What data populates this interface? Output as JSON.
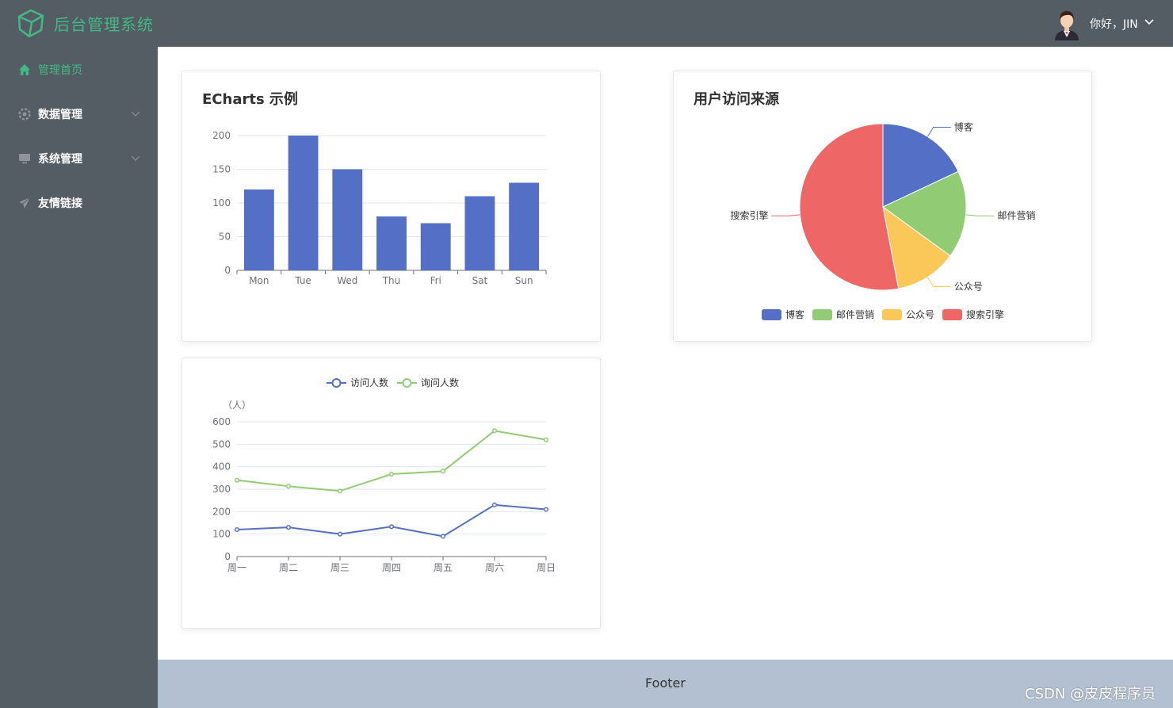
{
  "header": {
    "title": "后台管理系统",
    "greeting": "你好，JIN"
  },
  "sidebar": {
    "items": [
      {
        "label": "管理首页",
        "icon": "home-icon",
        "active": true
      },
      {
        "label": "数据管理",
        "icon": "settings-icon",
        "expandable": true
      },
      {
        "label": "系统管理",
        "icon": "monitor-icon",
        "expandable": true
      },
      {
        "label": "友情链接",
        "icon": "send-icon"
      }
    ]
  },
  "cards": {
    "bar_title": "ECharts 示例",
    "pie_title": "用户访问来源"
  },
  "footer": {
    "text": "Footer"
  },
  "watermark": "CSDN @皮皮程序员",
  "colors": {
    "accent": "#42b983",
    "sidebar": "#545c64",
    "footer": "#b3c0d1",
    "blue": "#5470c6",
    "green": "#91cc75",
    "yellow": "#fac858",
    "red": "#ee6666"
  },
  "chart_data": [
    {
      "type": "bar",
      "categories": [
        "Mon",
        "Tue",
        "Wed",
        "Thu",
        "Fri",
        "Sat",
        "Sun"
      ],
      "values": [
        120,
        200,
        150,
        80,
        70,
        110,
        130
      ],
      "ylim": [
        0,
        200
      ],
      "yticks": [
        0,
        50,
        100,
        150,
        200
      ]
    },
    {
      "type": "pie",
      "series": [
        {
          "name": "博客",
          "value": 18
        },
        {
          "name": "邮件营销",
          "value": 17
        },
        {
          "name": "公众号",
          "value": 12
        },
        {
          "name": "搜索引擎",
          "value": 53
        }
      ],
      "legend": "bottom"
    },
    {
      "type": "line",
      "categories": [
        "周一",
        "周二",
        "周三",
        "周四",
        "周五",
        "周六",
        "周日"
      ],
      "ylabel": "（人）",
      "ylim": [
        0,
        600
      ],
      "yticks": [
        0,
        100,
        200,
        300,
        400,
        500,
        600
      ],
      "legend": "top",
      "series": [
        {
          "name": "访问人数",
          "values": [
            120,
            130,
            100,
            133,
            90,
            230,
            210
          ]
        },
        {
          "name": "询问人数",
          "values": [
            340,
            313,
            292,
            367,
            380,
            560,
            520
          ]
        }
      ]
    }
  ]
}
